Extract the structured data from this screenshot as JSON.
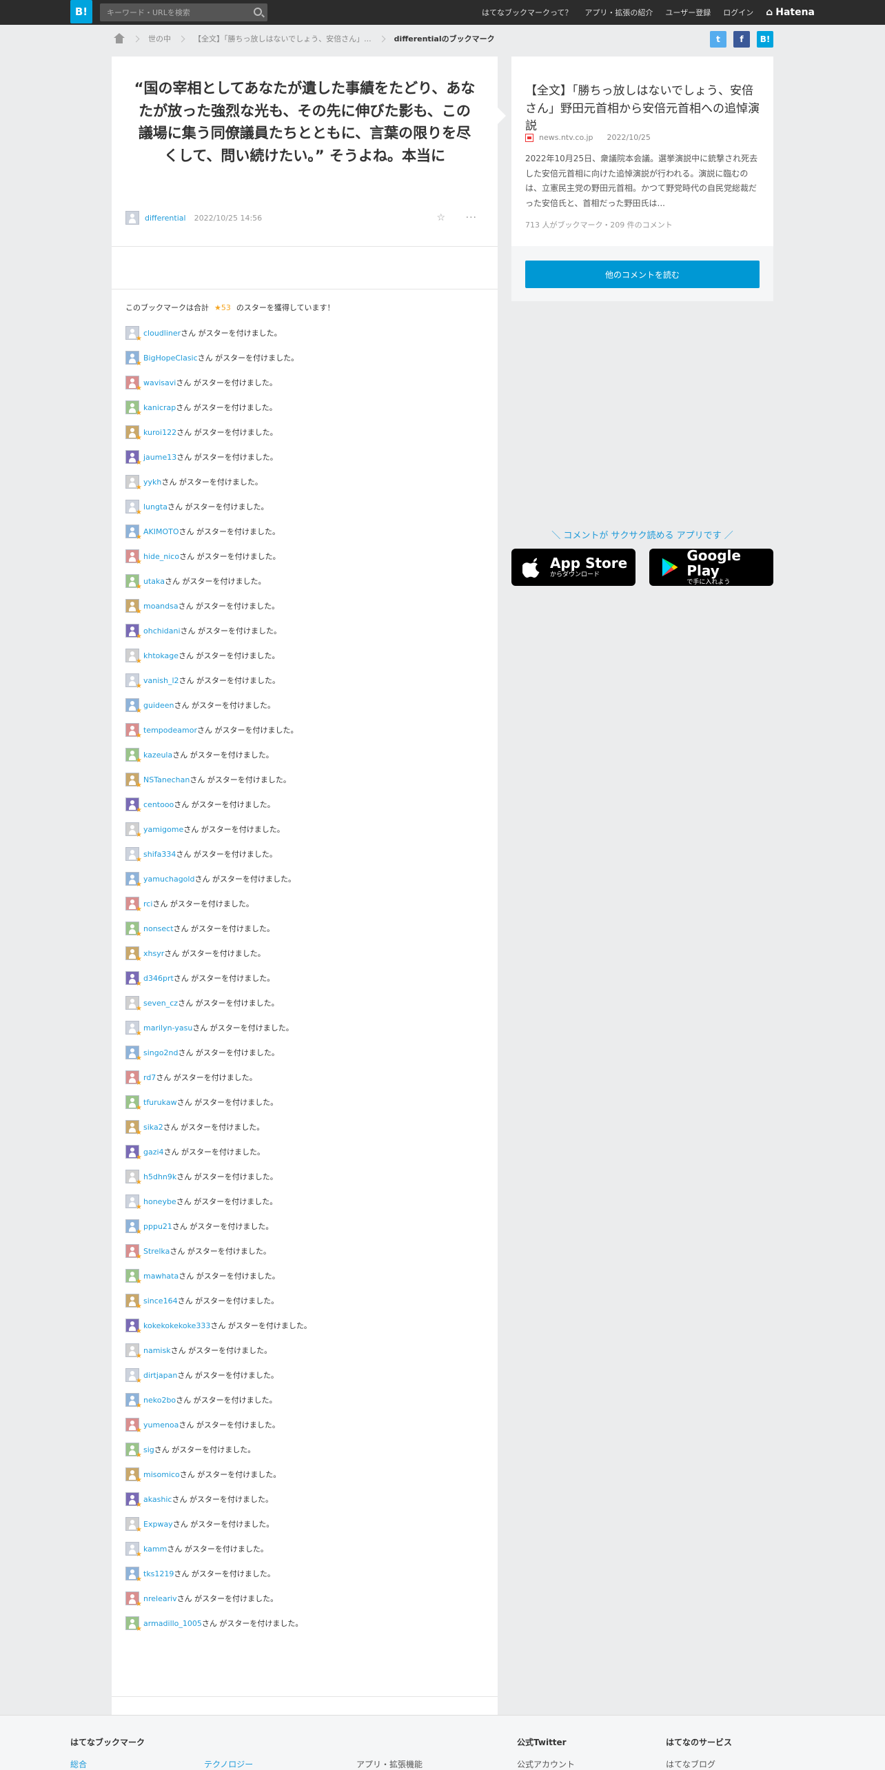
{
  "header": {
    "logo": "B!",
    "search_placeholder": "キーワード・URLを検索",
    "nav": [
      "はてなブックマークって？",
      "アプリ・拡張の紹介",
      "ユーザー登録",
      "ログイン"
    ],
    "brand": "Hatena"
  },
  "breadcrumb": {
    "items": [
      "世の中",
      "【全文】「勝ちっ放しはないでしょう、安倍さん」..."
    ],
    "current": "differentialのブックマーク"
  },
  "share": [
    "t",
    "f",
    "B!"
  ],
  "bookmark": {
    "comment": "“国の宰相としてあなたが遺した事績をたどり、あなたが放った強烈な光も、その先に伸びた影も、この議場に集う同僚議員たちとともに、言葉の限りを尽くして、問い続けたい。” そうよね。本当に",
    "user": "differential",
    "date": "2022/10/25 14:56",
    "star_icon": "☆",
    "more": "···"
  },
  "stars": {
    "summary_prefix": "このブックマークは合計",
    "count": "★53",
    "summary_suffix": "のスターを獲得しています！",
    "suffix": "さん がスターを付けました。",
    "users": [
      "cloudliner",
      "BigHopeClasic",
      "wavisavi",
      "kanicrap",
      "kuroi122",
      "jaume13",
      "yykh",
      "lungta",
      "AKIMOTO",
      "hide_nico",
      "utaka",
      "moandsa",
      "ohchidani",
      "khtokage",
      "vanish_l2",
      "guideen",
      "tempodeamor",
      "kazeula",
      "NSTanechan",
      "centooo",
      "yamigome",
      "shifa334",
      "yamuchagold",
      "rci",
      "nonsect",
      "xhsyr",
      "d346prt",
      "seven_cz",
      "marilyn-yasu",
      "singo2nd",
      "rd7",
      "tfurukaw",
      "sika2",
      "gazi4",
      "h5dhn9k",
      "honeybe",
      "pppu21",
      "Strelka",
      "mawhata",
      "since164",
      "kokekokekoke333",
      "namisk",
      "dirtjapan",
      "neko2bo",
      "yumenoa",
      "sig",
      "misomico",
      "akashic",
      "Expway",
      "kamm",
      "tks1219",
      "nreleariv",
      "armadillo_1005"
    ]
  },
  "entry": {
    "title": "【全文】「勝ちっ放しはないでしょう、安倍さん」野田元首相から安倍元首相への追悼演説",
    "domain": "news.ntv.co.jp",
    "date": "2022/10/25",
    "summary": "2022年10月25日、衆議院本会議。選挙演説中に銃撃され死去した安倍元首相に向けた追悼演説が行われる。演説に臨むのは、立憲民主党の野田元首相。かつて野党時代の自民党総裁だった安倍氏と、首相だった野田氏は...",
    "counts": "713 人がブックマーク・209 件のコメント",
    "more_button": "他のコメントを読む"
  },
  "promo": {
    "text": "＼ コメントが サクサク読める アプリです ／",
    "appstore_big": "App Store",
    "appstore_small": "からダウンロード",
    "gplay_big": "Google Play",
    "gplay_small": "で手に入れよう"
  },
  "footer": {
    "col1_title": "はてなブックマーク",
    "col1_links": [
      "総合",
      "テクノロジー",
      "アプリ・拡張機能"
    ],
    "col2_title": "公式Twitter",
    "col2_link": "公式アカウント",
    "col3_title": "はてなのサービス",
    "col3_link": "はてなブログ"
  },
  "colors": {
    "accent": "#00a4de",
    "star": "#f5a623",
    "twitter": "#55acee",
    "facebook": "#3b5998"
  }
}
